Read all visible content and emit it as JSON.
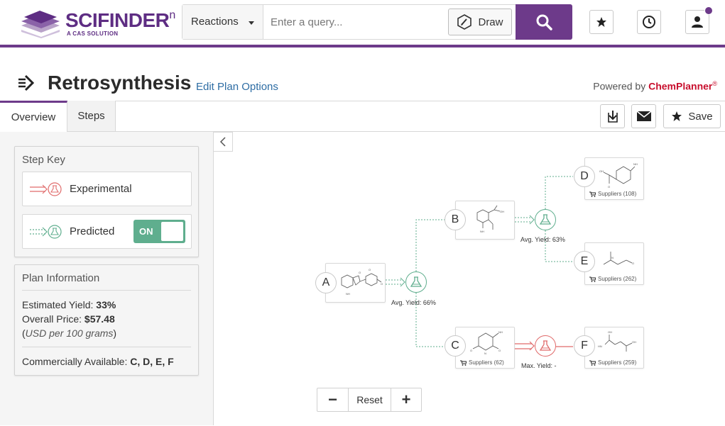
{
  "header": {
    "logo_main": "SCIFINDER",
    "logo_sup": "n",
    "logo_sub": "A CAS SOLUTION",
    "search_type": "Reactions",
    "search_placeholder": "Enter a query...",
    "draw_label": "Draw",
    "accent_color": "#6d3a8a"
  },
  "title": {
    "text": "Retrosynthesis",
    "edit_link": "Edit Plan Options",
    "powered_prefix": "Powered by",
    "powered_brand": "ChemPlanner",
    "powered_mark": "®"
  },
  "tabs": [
    {
      "label": "Overview",
      "active": true
    },
    {
      "label": "Steps",
      "active": false
    }
  ],
  "toolbar": {
    "save_label": "Save"
  },
  "step_key": {
    "title": "Step Key",
    "experimental_label": "Experimental",
    "predicted_label": "Predicted",
    "toggle_label": "ON",
    "experimental_color": "#e06b6b",
    "predicted_color": "#5fae8e"
  },
  "plan_info": {
    "title": "Plan Information",
    "yield_label": "Estimated Yield:",
    "yield_value": "33%",
    "price_label": "Overall Price:",
    "price_value": "$57.48",
    "price_note_open": "(",
    "price_note_unit": "USD per 100 grams",
    "price_note_close": ")",
    "available_label": "Commercially Available:",
    "available_value": "C, D, E, F"
  },
  "diagram": {
    "nodes": {
      "A": {
        "letter": "A"
      },
      "B": {
        "letter": "B"
      },
      "C": {
        "letter": "C",
        "suppliers": "Suppliers (62)"
      },
      "D": {
        "letter": "D",
        "suppliers": "Suppliers (108)"
      },
      "E": {
        "letter": "E",
        "suppliers": "Suppliers (262)"
      },
      "F": {
        "letter": "F",
        "suppliers": "Suppliers (259)"
      }
    },
    "steps": {
      "a": {
        "label": "Avg. Yield: 66%"
      },
      "b": {
        "label": "Avg. Yield: 63%"
      },
      "c": {
        "label": "Max. Yield: -"
      }
    },
    "atoms": {
      "oh": "OH",
      "nh2": "NH",
      "o": "O",
      "n": "N",
      "hn": "HN"
    }
  },
  "zoom": {
    "minus": "−",
    "reset": "Reset",
    "plus": "+"
  }
}
